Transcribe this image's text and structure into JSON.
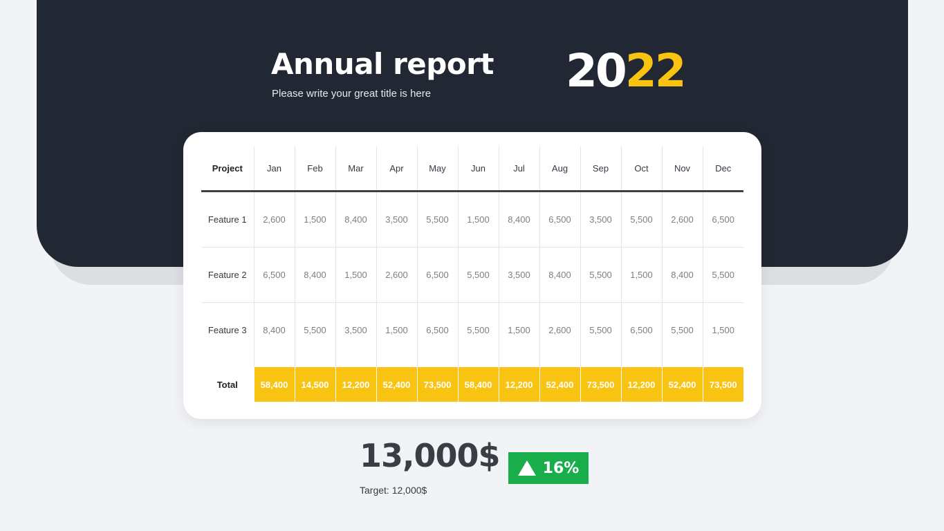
{
  "header": {
    "title": "Annual report",
    "subtitle": "Please write your great title is here",
    "year_prefix": "20",
    "year_suffix": "22"
  },
  "table": {
    "project_header": "Project",
    "months": [
      "Jan",
      "Feb",
      "Mar",
      "Apr",
      "May",
      "Jun",
      "Jul",
      "Aug",
      "Sep",
      "Oct",
      "Nov",
      "Dec"
    ],
    "rows": [
      {
        "label": "Feature 1",
        "values": [
          "2,600",
          "1,500",
          "8,400",
          "3,500",
          "5,500",
          "1,500",
          "8,400",
          "6,500",
          "3,500",
          "5,500",
          "2,600",
          "6,500"
        ]
      },
      {
        "label": "Feature 2",
        "values": [
          "6,500",
          "8,400",
          "1,500",
          "2,600",
          "6,500",
          "5,500",
          "3,500",
          "8,400",
          "5,500",
          "1,500",
          "8,400",
          "5,500"
        ]
      },
      {
        "label": "Feature 3",
        "values": [
          "8,400",
          "5,500",
          "3,500",
          "1,500",
          "6,500",
          "5,500",
          "1,500",
          "2,600",
          "5,500",
          "6,500",
          "5,500",
          "1,500"
        ]
      }
    ],
    "total": {
      "label": "Total",
      "values": [
        "58,400",
        "14,500",
        "12,200",
        "52,400",
        "73,500",
        "58,400",
        "12,200",
        "52,400",
        "73,500",
        "12,200",
        "52,400",
        "73,500"
      ]
    }
  },
  "summary": {
    "amount": "13,000$",
    "target": "Target: 12,000$",
    "change": "16%",
    "change_icon": "triangle-up-icon"
  },
  "colors": {
    "dark": "#222833",
    "accent_yellow": "#f8c311",
    "positive_green": "#1aad4c"
  }
}
